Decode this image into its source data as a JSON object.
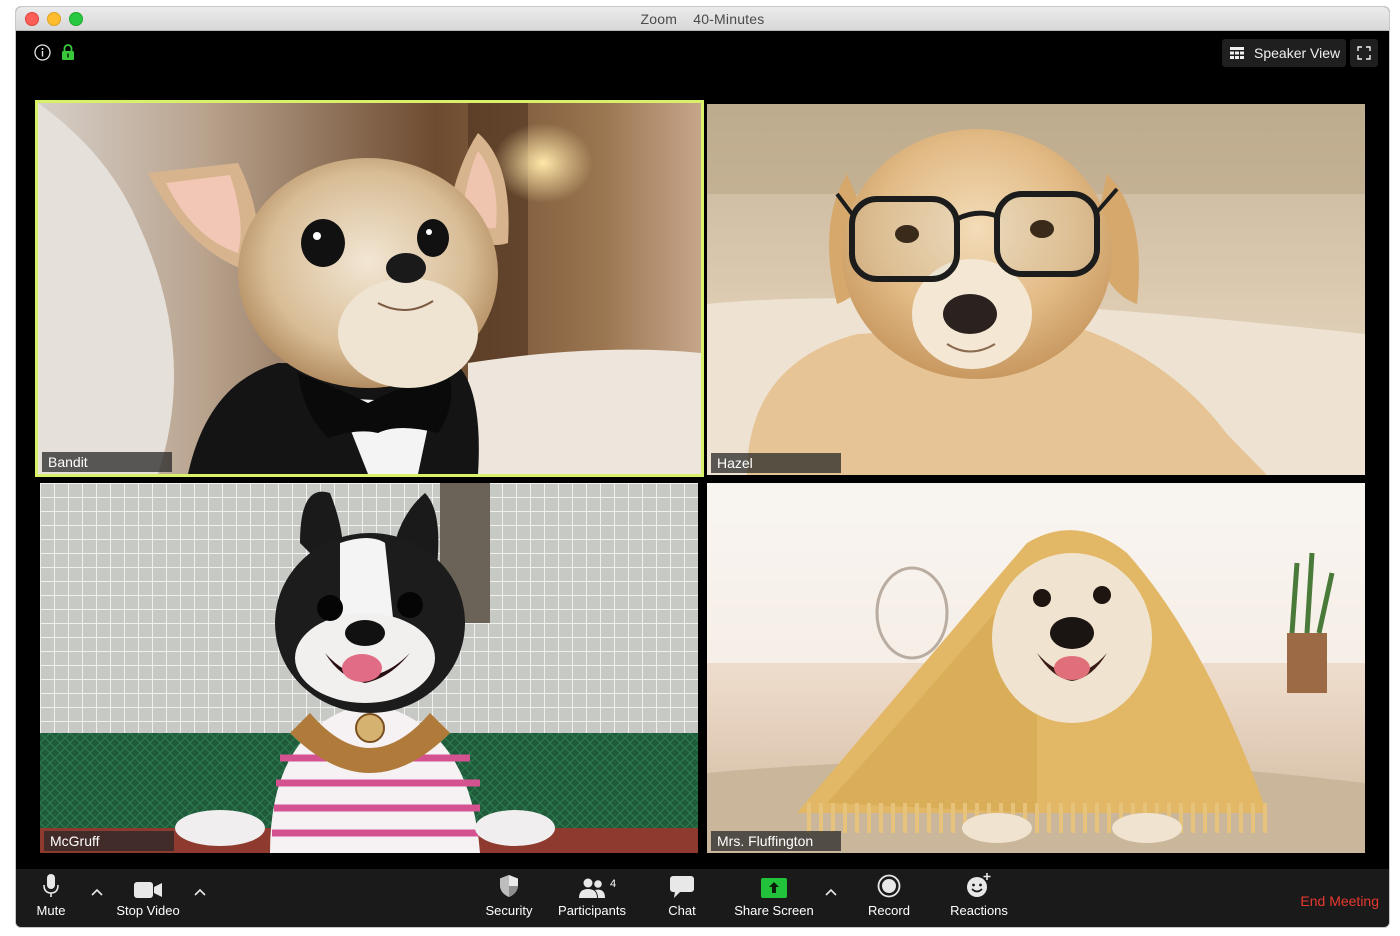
{
  "window": {
    "app_name": "Zoom",
    "meeting_title": "40-Minutes"
  },
  "top_bar": {
    "speaker_view_label": "Speaker View"
  },
  "participants": [
    {
      "name": "Bandit",
      "active_speaker": true
    },
    {
      "name": "Hazel",
      "active_speaker": false
    },
    {
      "name": "McGruff",
      "active_speaker": false
    },
    {
      "name": "Mrs. Fluffington",
      "active_speaker": false
    }
  ],
  "toolbar": {
    "mute_label": "Mute",
    "stop_video_label": "Stop Video",
    "security_label": "Security",
    "participants_label": "Participants",
    "participants_count": "4",
    "chat_label": "Chat",
    "share_screen_label": "Share Screen",
    "record_label": "Record",
    "reactions_label": "Reactions",
    "end_meeting_label": "End Meeting"
  },
  "colors": {
    "active_speaker_border": "#d9f06b",
    "share_screen_green": "#22c23a",
    "end_meeting_red": "#e8392e",
    "lock_green": "#3ac93a"
  },
  "icons": {
    "info": "info-icon",
    "lock": "lock-icon",
    "speaker_view": "grid-icon",
    "fullscreen": "fullscreen-icon",
    "mute": "microphone-icon",
    "stop_video": "video-camera-icon",
    "security": "shield-icon",
    "participants": "people-icon",
    "chat": "chat-bubble-icon",
    "share_screen": "share-screen-icon",
    "record": "record-icon",
    "reactions": "smiley-add-icon"
  }
}
